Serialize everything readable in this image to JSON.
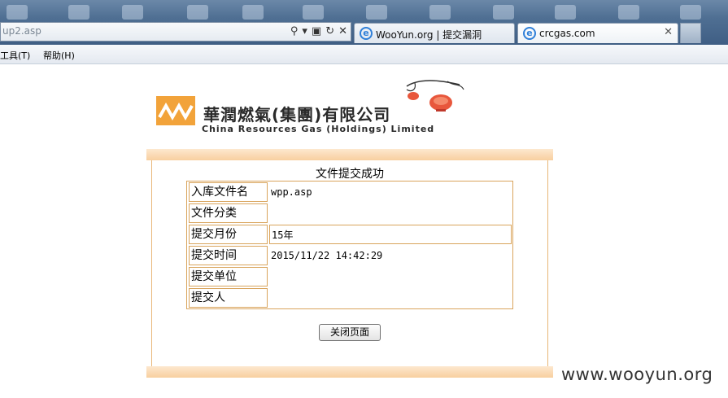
{
  "browser": {
    "address": "up2.asp",
    "tabs": [
      {
        "title": "WooYun.org | 提交漏洞"
      },
      {
        "title": "crcgas.com"
      }
    ],
    "menu": [
      "工具(T)",
      "帮助(H)"
    ]
  },
  "logo": {
    "cn": "華潤燃氣(集團)有限公司",
    "en": "China Resources Gas (Holdings) Limited"
  },
  "form": {
    "title": "文件提交成功",
    "rows": [
      {
        "label": "入库文件名",
        "value": "wpp.asp"
      },
      {
        "label": "文件分类",
        "value": ""
      },
      {
        "label": "提交月份",
        "value": "15年"
      },
      {
        "label": "提交时间",
        "value": "2015/11/22 14:42:29"
      },
      {
        "label": "提交单位",
        "value": ""
      },
      {
        "label": "提交人",
        "value": ""
      }
    ],
    "close_label": "关闭页面"
  },
  "watermark": "www.wooyun.org",
  "colors": {
    "accent": "#f2a33a",
    "border": "#d9a45c"
  }
}
